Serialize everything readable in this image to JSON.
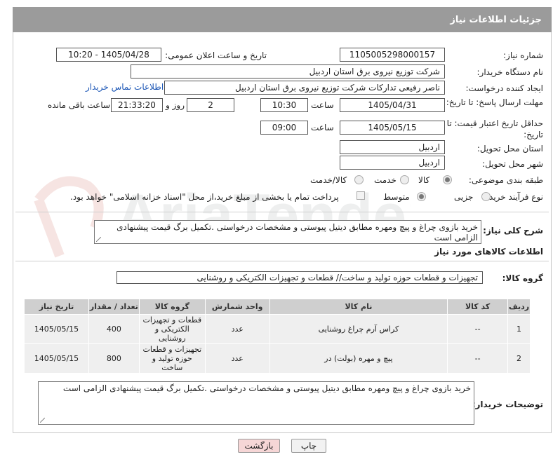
{
  "header": {
    "title": "جزئیات اطلاعات نیاز"
  },
  "fields": {
    "need_number_label": "شماره نیاز:",
    "need_number": "1105005298000157",
    "announce_label": "تاریخ و ساعت اعلان عمومی:",
    "announce_value": "1405/04/28 - 10:20",
    "buyer_org_label": "نام دستگاه خریدار:",
    "buyer_org": "شرکت توزیع نیروی برق استان اردبیل",
    "creator_label": "ایجاد کننده درخواست:",
    "creator": "ناصر رفیعی تدارکات شرکت توزیع نیروی برق استان اردبیل",
    "contact_link": "اطلاعات تماس خریدار",
    "deadline_label": "مهلت ارسال پاسخ: تا تاریخ:",
    "deadline_date": "1405/04/31",
    "time_label": "ساعت",
    "deadline_time": "10:30",
    "days_value": "2",
    "days_label": "روز و",
    "remaining_time": "21:33:20",
    "remaining_label": "ساعت باقی مانده",
    "validity_label": "حداقل تاریخ اعتبار قیمت: تا تاریخ:",
    "validity_date": "1405/05/15",
    "validity_time": "09:00",
    "province_label": "استان محل تحویل:",
    "province": "اردبیل",
    "city_label": "شهر محل تحویل:",
    "city": "اردبیل",
    "category_label": "طبقه بندی موضوعی:",
    "category_options": [
      "کالا",
      "خدمت",
      "کالا/خدمت"
    ],
    "process_label": "نوع فرآیند خرید :",
    "process_options": [
      "جزیی",
      "متوسط"
    ],
    "payment_note": "پرداخت تمام یا بخشی از مبلغ خرید،از محل \"اسناد خزانه اسلامی\" خواهد بود."
  },
  "description": {
    "label": "شرح کلی نیاز:",
    "text": "خرید بازوی چراغ و پیچ ومهره مطابق دیتیل پیوستی و مشخصات درخواستی .تکمیل برگ قیمت پیشنهادی الزامی است"
  },
  "goods": {
    "section_title": "اطلاعات کالاهای مورد نیاز",
    "group_label": "گروه کالا:",
    "group_value": "تجهیزات و قطعات حوزه تولید و ساخت// قطعات و تجهیزات الکتریکی و روشنایی",
    "columns": [
      "ردیف",
      "کد کالا",
      "نام کالا",
      "واحد شمارش",
      "گروه کالا",
      "تعداد / مقدار",
      "تاریخ نیاز"
    ],
    "rows": [
      {
        "row": "1",
        "code": "--",
        "name": "کراس آرم چراغ روشنایی",
        "unit": "عدد",
        "group": "قطعات و تجهیزات الکتریکی و روشنایی",
        "qty": "400",
        "date": "1405/05/15"
      },
      {
        "row": "2",
        "code": "--",
        "name": "پیچ و مهره (بولت) در",
        "unit": "عدد",
        "group": "تجهیزات و قطعات حوزه تولید و ساخت",
        "qty": "800",
        "date": "1405/05/15"
      }
    ]
  },
  "buyer_notes": {
    "label": "توضیحات خریدار:",
    "text": "خرید بازوی چراغ و پیچ ومهره مطابق دیتیل پیوستی و مشخصات درخواستی .تکمیل برگ قیمت پیشنهادی الزامی است"
  },
  "buttons": {
    "print": "چاپ",
    "back": "بازگشت"
  },
  "watermark": {
    "text": "AriaTender.net"
  },
  "colors": {
    "header_bg": "#9b9b9b",
    "link": "#1a55b5",
    "back_button_bg": "#f6d6d6"
  }
}
